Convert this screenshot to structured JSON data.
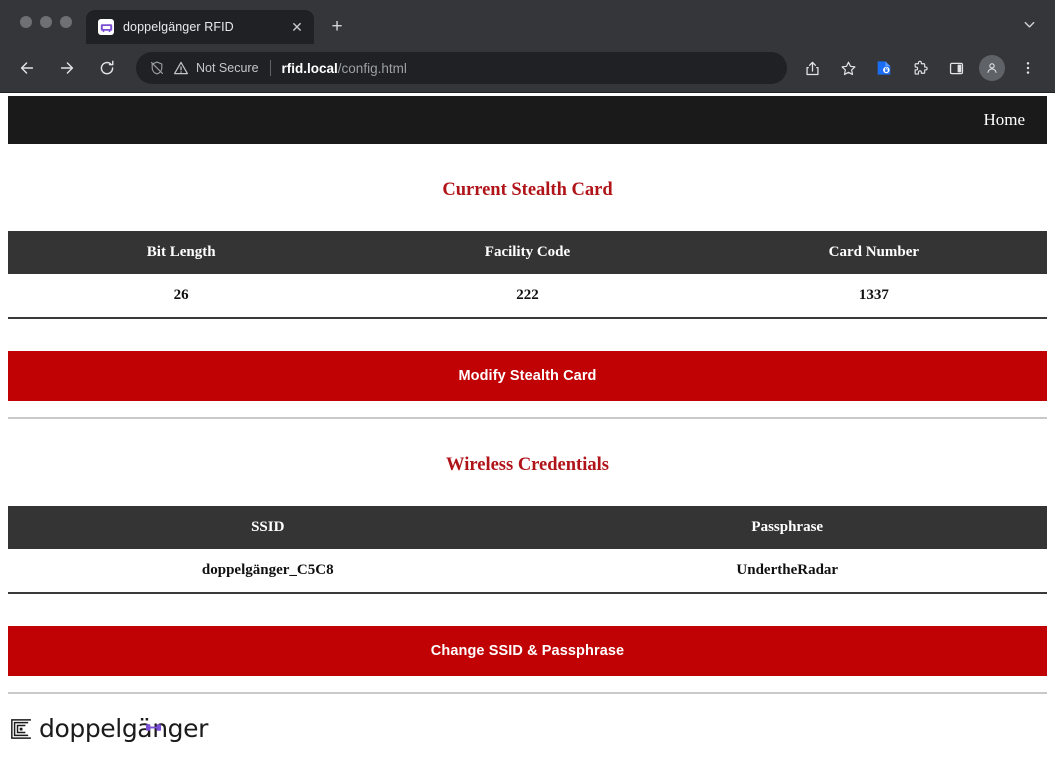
{
  "browser": {
    "traffic_lights": [
      "close",
      "minimize",
      "maximize"
    ],
    "tab": {
      "title": "doppelgänger RFID",
      "favicon_name": "rfid-tag-favicon",
      "close_label": "✕"
    },
    "new_tab_label": "+",
    "tab_list_icon": "chevron-down-icon",
    "toolbar": {
      "back_icon": "back-arrow-icon",
      "forward_icon": "forward-arrow-icon",
      "reload_icon": "reload-icon",
      "omnibox": {
        "tracking_icon": "tracking-protection-off-icon",
        "warning_icon": "warning-triangle-icon",
        "security_label": "Not Secure",
        "url_host": "rfid.local",
        "url_path": "/config.html"
      },
      "share_icon": "share-icon",
      "bookmark_icon": "bookmark-star-icon",
      "password_icon": "password-manager-icon",
      "extensions_icon": "extensions-puzzle-icon",
      "side_panel_icon": "side-panel-icon",
      "profile_icon": "profile-avatar-icon",
      "menu_icon": "three-dot-menu-icon"
    }
  },
  "page": {
    "nav": {
      "home_label": "Home"
    },
    "stealth_card": {
      "title": "Current Stealth Card",
      "columns": [
        "Bit Length",
        "Facility Code",
        "Card Number"
      ],
      "row": [
        "26",
        "222",
        "1337"
      ],
      "button_label": "Modify Stealth Card"
    },
    "wireless": {
      "title": "Wireless Credentials",
      "columns": [
        "SSID",
        "Passphrase"
      ],
      "row": [
        "doppelgänger_C5C8",
        "UndertheRadar"
      ],
      "button_label": "Change SSID & Passphrase"
    },
    "footer": {
      "logo_text": "doppelgänger",
      "logo_mark_name": "rfid-coil-logo-icon",
      "umlaut_name": "rfid-antenna-umlaut-icon"
    }
  },
  "colors": {
    "accent_red": "#b01318",
    "button_red": "#c00204",
    "nav_dark": "#1a1a1a",
    "table_header": "#343434",
    "umlaut_purple": "#7b4fd6",
    "browser_chrome": "#35363a",
    "tab_active": "#202124"
  }
}
